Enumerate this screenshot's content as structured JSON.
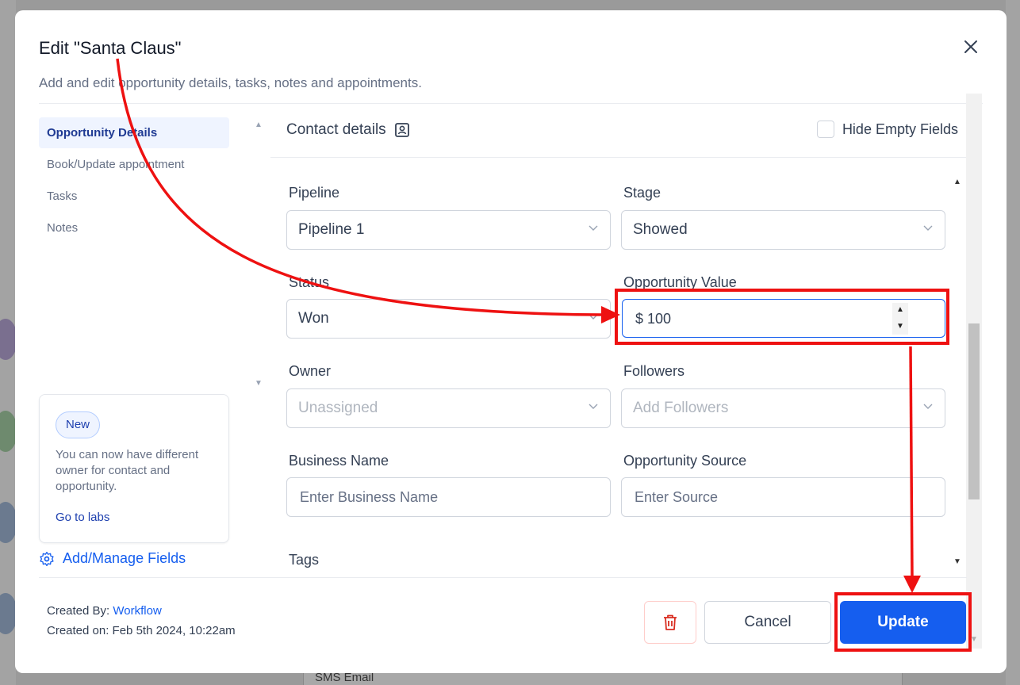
{
  "modal": {
    "title": "Edit \"Santa Claus\"",
    "subtitle": "Add and edit opportunity details, tasks, notes and appointments."
  },
  "nav": {
    "items": [
      {
        "label": "Opportunity Details",
        "active": true
      },
      {
        "label": "Book/Update appointment",
        "active": false
      },
      {
        "label": "Tasks",
        "active": false
      },
      {
        "label": "Notes",
        "active": false
      }
    ]
  },
  "promo": {
    "badge": "New",
    "text": "You can now have different owner for contact and opportunity.",
    "link": "Go to labs"
  },
  "manage_fields": "Add/Manage Fields",
  "panel": {
    "title": "Contact details",
    "hide_empty_label": "Hide Empty Fields"
  },
  "fields": {
    "pipeline": {
      "label": "Pipeline",
      "value": "Pipeline 1"
    },
    "stage": {
      "label": "Stage",
      "value": "Showed"
    },
    "status": {
      "label": "Status",
      "value": "Won"
    },
    "opportunity_value": {
      "label": "Opportunity Value",
      "value": "$ 100"
    },
    "owner": {
      "label": "Owner",
      "placeholder": "Unassigned"
    },
    "followers": {
      "label": "Followers",
      "placeholder": "Add Followers"
    },
    "business_name": {
      "label": "Business Name",
      "placeholder": "Enter Business Name"
    },
    "opportunity_source": {
      "label": "Opportunity Source",
      "placeholder": "Enter Source"
    },
    "tags": {
      "label": "Tags"
    }
  },
  "footer": {
    "created_by_label": "Created By:",
    "created_by_value": "Workflow",
    "created_on": "Created on: Feb 5th 2024, 10:22am",
    "cancel": "Cancel",
    "update": "Update"
  },
  "background": {
    "sms_tab": "SMS   Email"
  },
  "colors": {
    "primary": "#155eef",
    "annotation": "#ee1111",
    "delete": "#d92d20"
  }
}
